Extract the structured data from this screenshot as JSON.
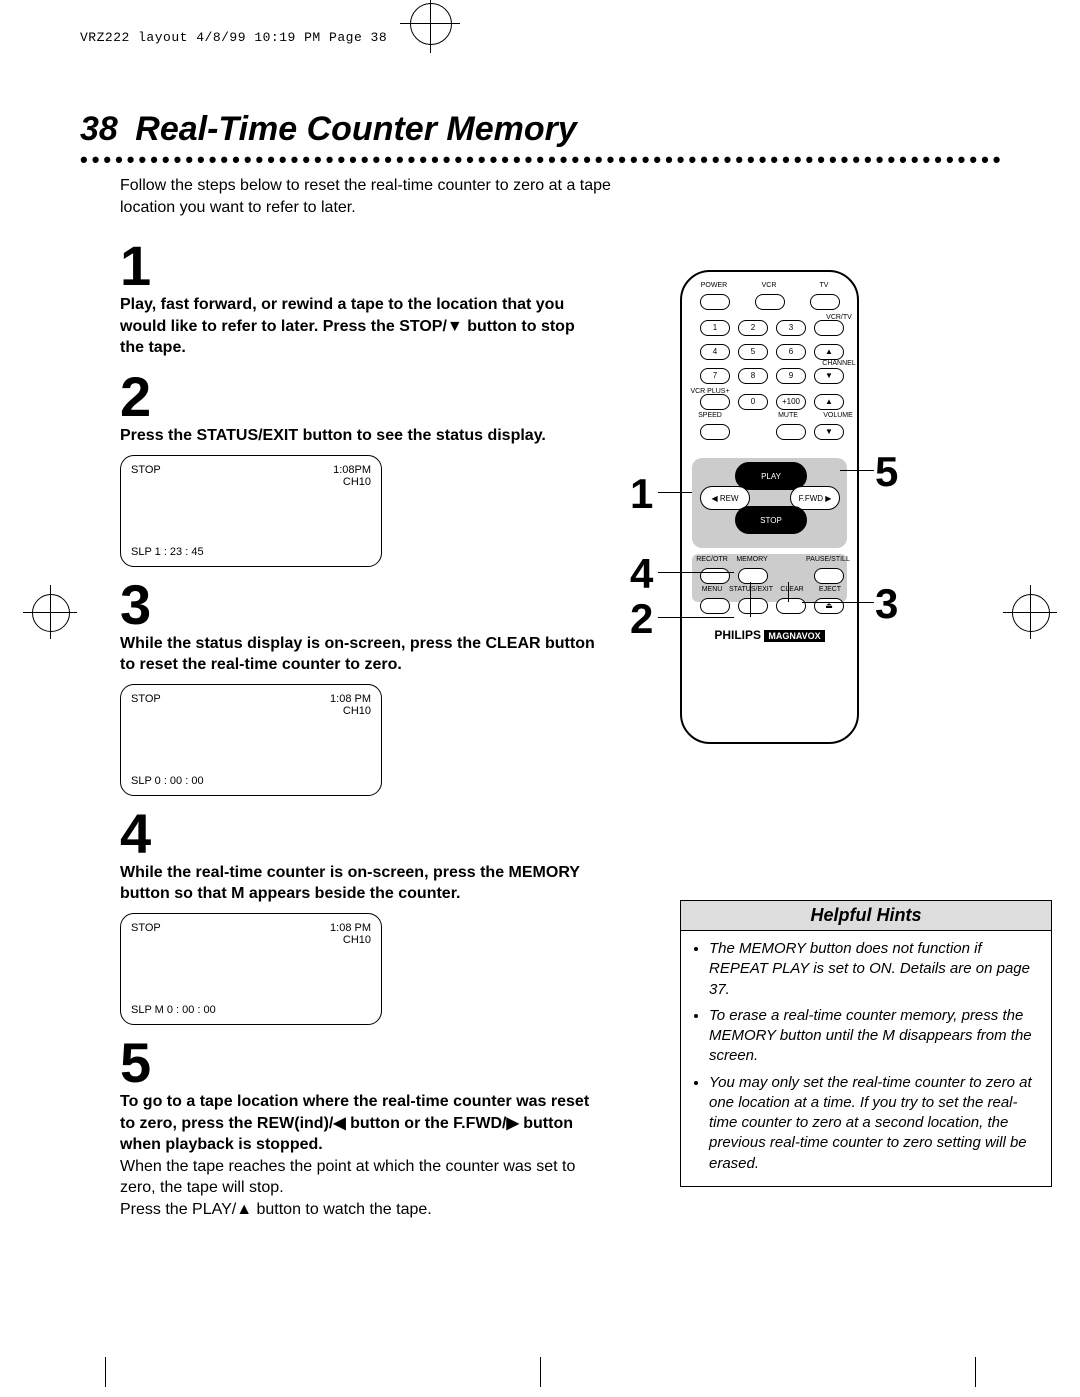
{
  "slug": "VRZ222 layout  4/8/99 10:19 PM  Page 38",
  "page_number": "38",
  "title": "Real-Time Counter Memory",
  "intro": "Follow the steps below to reset the real-time counter to zero at a tape location you want to refer to later.",
  "steps": [
    {
      "n": "1",
      "html": "Play, fast forward, or rewind a tape to the location that you would like to refer to later. Press the STOP/▼ button to stop the tape."
    },
    {
      "n": "2",
      "html": "Press the STATUS/EXIT button to see the status display."
    },
    {
      "n": "3",
      "html": "While the status display is on-screen, press the CLEAR button to reset the real-time counter to zero."
    },
    {
      "n": "4",
      "html": "While the real-time counter is on-screen, press the MEMORY button so that M appears beside the counter."
    },
    {
      "n": "5",
      "html": "To go to a tape location where the real-time counter was reset to zero, press the REW(ind)/◀ button or the F.FWD/▶ button when playback is stopped."
    }
  ],
  "step5_extra1": "When the tape reaches the point at which the counter was set to zero, the tape will stop.",
  "step5_extra2": "Press the PLAY/▲ button to watch the tape.",
  "tv_screens": [
    {
      "tl": "STOP",
      "tr1": "1:08PM",
      "tr2": "CH10",
      "bl": "SLP        1 : 23 : 45"
    },
    {
      "tl": "STOP",
      "tr1": "1:08 PM",
      "tr2": "CH10",
      "bl": "SLP        0 : 00 : 00"
    },
    {
      "tl": "STOP",
      "tr1": "1:08 PM",
      "tr2": "CH10",
      "bl": "SLP    M  0 : 00 : 00"
    }
  ],
  "remote": {
    "top_labels": [
      "POWER",
      "VCR",
      "TV"
    ],
    "side_label_right": "VCR/TV",
    "channel_label": "CHANNEL",
    "vcrplus_label": "VCR PLUS+",
    "speed_label": "SPEED",
    "mute_label": "MUTE",
    "volume_label": "VOLUME",
    "numbers": [
      "1",
      "2",
      "3",
      "4",
      "5",
      "6",
      "7",
      "8",
      "9",
      "0",
      "+100"
    ],
    "play": "PLAY",
    "rew": "◀ REW",
    "ffwd": "F.FWD ▶",
    "stop": "STOP",
    "row_a": [
      "REC/OTR",
      "MEMORY",
      "",
      "PAUSE/STILL"
    ],
    "row_b": [
      "MENU",
      "STATUS/EXIT",
      "CLEAR",
      "EJECT"
    ],
    "brand1": "PHILIPS",
    "brand2": "MAGNAVOX"
  },
  "callouts": {
    "c1": "1",
    "c2": "2",
    "c3": "3",
    "c4": "4",
    "c5": "5"
  },
  "hints_title": "Helpful Hints",
  "hints": [
    "The MEMORY button does not function if REPEAT PLAY is set to ON. Details are on page 37.",
    "To erase a real-time counter memory, press the MEMORY button until the M disappears from the screen.",
    "You may only set the real-time counter to zero at one location at a time. If you try to set the real-time counter to zero at a second location, the previous real-time counter to zero setting will be erased."
  ]
}
